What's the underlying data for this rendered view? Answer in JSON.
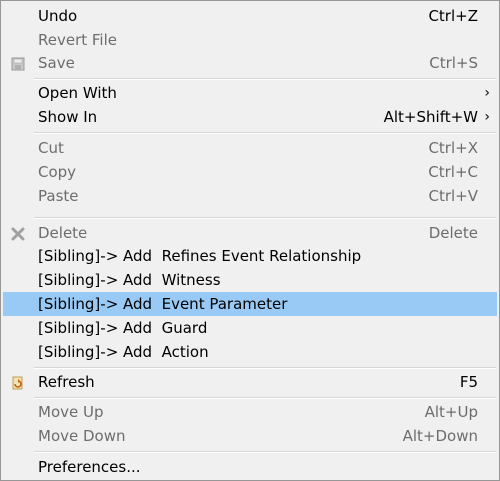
{
  "menu": {
    "undo": {
      "label": "Undo",
      "shortcut": "Ctrl+Z"
    },
    "revert_file": {
      "label": "Revert File"
    },
    "save": {
      "label": "Save",
      "shortcut": "Ctrl+S",
      "icon": "save-icon"
    },
    "open_with": {
      "label": "Open With",
      "submenu": "›"
    },
    "show_in": {
      "label": "Show In",
      "shortcut": "Alt+Shift+W",
      "submenu": "›"
    },
    "cut": {
      "label": "Cut",
      "shortcut": "Ctrl+X"
    },
    "copy": {
      "label": "Copy",
      "shortcut": "Ctrl+C"
    },
    "paste": {
      "label": "Paste",
      "shortcut": "Ctrl+V"
    },
    "delete": {
      "label": "Delete",
      "shortcut": "Delete",
      "icon": "delete-icon"
    },
    "add_refines": {
      "label": "[Sibling]-> Add  Refines Event Relationship"
    },
    "add_witness": {
      "label": "[Sibling]-> Add  Witness"
    },
    "add_event_param": {
      "label": "[Sibling]-> Add  Event Parameter"
    },
    "add_guard": {
      "label": "[Sibling]-> Add  Guard"
    },
    "add_action": {
      "label": "[Sibling]-> Add  Action"
    },
    "refresh": {
      "label": "Refresh",
      "shortcut": "F5",
      "icon": "refresh-icon"
    },
    "move_up": {
      "label": "Move Up",
      "shortcut": "Alt+Up"
    },
    "move_down": {
      "label": "Move Down",
      "shortcut": "Alt+Down"
    },
    "preferences": {
      "label": "Preferences..."
    }
  },
  "colors": {
    "selected_background": "#99c9f5",
    "disabled_text": "#6d6d6d",
    "menu_background": "#f0f0f0"
  }
}
